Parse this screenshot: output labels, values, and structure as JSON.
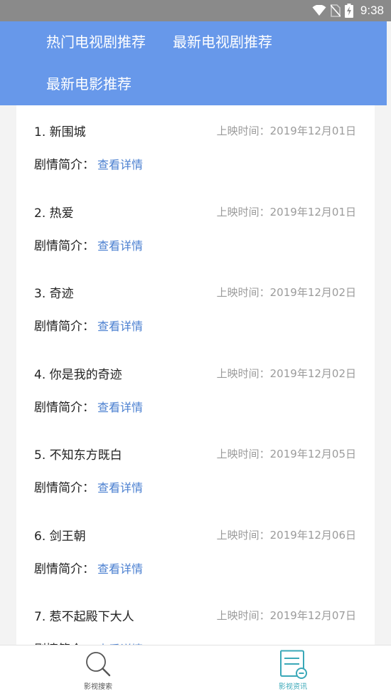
{
  "status_bar": {
    "time": "9:38",
    "icons": [
      "wifi-icon",
      "no-sim-icon",
      "battery-charging-icon"
    ]
  },
  "header": {
    "tabs": [
      {
        "label": "热门电视剧推荐"
      },
      {
        "label": "最新电视剧推荐"
      },
      {
        "label": "最新电影推荐"
      }
    ]
  },
  "list": {
    "date_prefix": "上映时间：",
    "desc_label": "剧情简介：",
    "link_label": "查看详情",
    "items": [
      {
        "title": "1. 新围城",
        "date": "2019年12月01日"
      },
      {
        "title": "2. 热爱",
        "date": "2019年12月01日"
      },
      {
        "title": "3. 奇迹",
        "date": "2019年12月02日"
      },
      {
        "title": "4. 你是我的奇迹",
        "date": "2019年12月02日"
      },
      {
        "title": "5. 不知东方既白",
        "date": "2019年12月05日"
      },
      {
        "title": "6. 剑王朝",
        "date": "2019年12月06日"
      },
      {
        "title": "7. 惹不起殿下大人",
        "date": "2019年12月07日"
      }
    ]
  },
  "bottom_nav": {
    "items": [
      {
        "label": "影视搜索",
        "icon": "search-icon",
        "active": false
      },
      {
        "label": "影视资讯",
        "icon": "news-document-icon",
        "active": true
      }
    ],
    "colors": {
      "active": "#3aa8b8",
      "inactive": "#555555"
    }
  },
  "colors": {
    "header_bg": "#6798ea",
    "status_bar_bg": "#8a8a8a",
    "link": "#4a7fd0",
    "date_text": "#9b9b9b"
  }
}
